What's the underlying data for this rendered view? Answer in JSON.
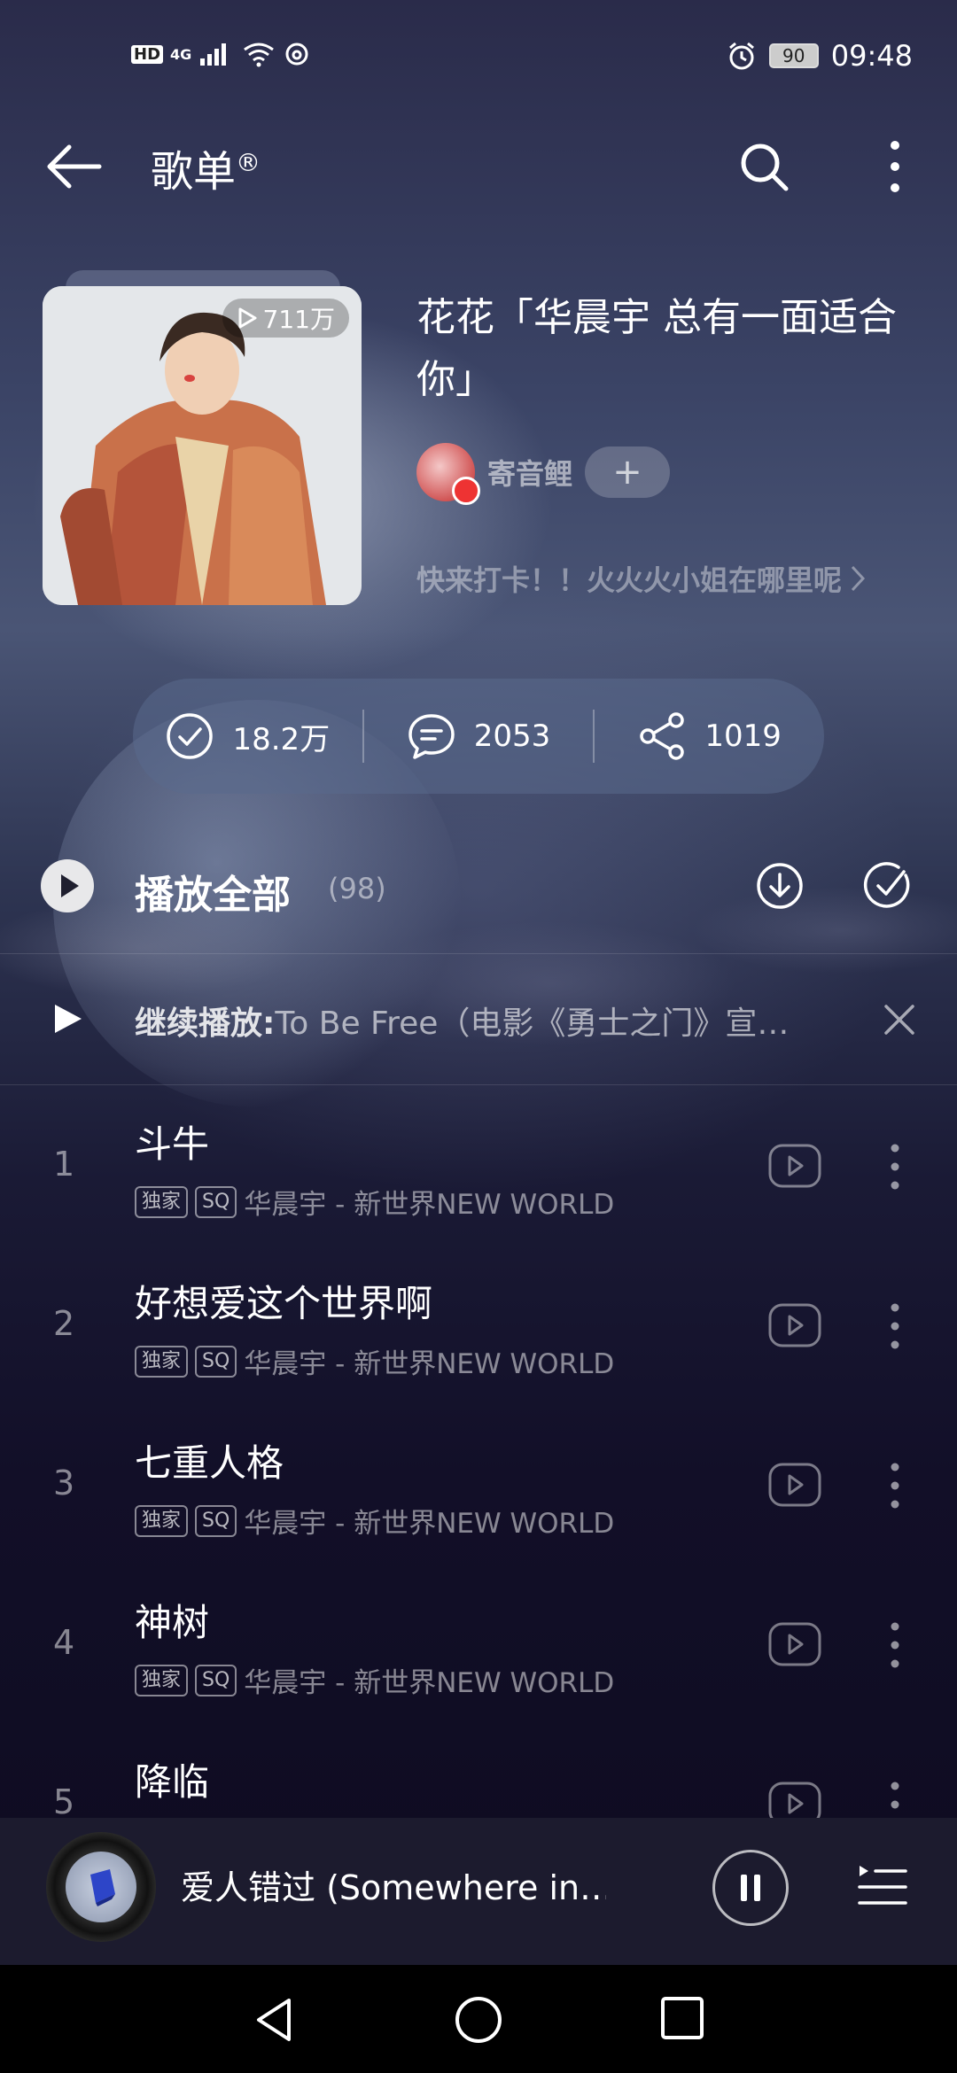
{
  "status_bar": {
    "network": "HD",
    "signal_type": "4G",
    "battery": "90",
    "time": "09:48"
  },
  "header": {
    "title": "歌单",
    "title_mark": "®"
  },
  "playlist": {
    "play_count": "711万",
    "title": "花花「华晨宇 总有一面适合你」",
    "creator_name": "寄音鲤",
    "follow_label": "+",
    "description": "快来打卡！！火火火小姐在哪里呢"
  },
  "stats": {
    "collect": "18.2万",
    "comments": "2053",
    "shares": "1019"
  },
  "play_all": {
    "label": "播放全部",
    "count": "(98)"
  },
  "resume": {
    "prefix": "继续播放:",
    "track": "To Be Free（电影《勇士之门》宣…"
  },
  "songs": [
    {
      "index": "1",
      "name": "斗牛",
      "tags": [
        "独家",
        "SQ"
      ],
      "artist_album": "华晨宇 - 新世界NEW WORLD"
    },
    {
      "index": "2",
      "name": "好想爱这个世界啊",
      "tags": [
        "独家",
        "SQ"
      ],
      "artist_album": "华晨宇 - 新世界NEW WORLD"
    },
    {
      "index": "3",
      "name": "七重人格",
      "tags": [
        "独家",
        "SQ"
      ],
      "artist_album": "华晨宇 - 新世界NEW WORLD"
    },
    {
      "index": "4",
      "name": "神树",
      "tags": [
        "独家",
        "SQ"
      ],
      "artist_album": "华晨宇 - 新世界NEW WORLD"
    },
    {
      "index": "5",
      "name": "降临",
      "tags": [],
      "artist_album": ""
    }
  ],
  "player": {
    "now_playing": "爱人错过 (Somewhere in…"
  },
  "colors": {
    "accent_red": "#e33333",
    "player_bg": "#1c1b2e",
    "stats_pill": "#5a698c"
  },
  "icons": {
    "back": "arrow-left-icon",
    "search": "search-icon",
    "more": "more-vertical-icon",
    "collect": "check-circle-icon",
    "comment": "comment-icon",
    "share": "share-icon",
    "download": "download-circle-icon",
    "multi_select": "check-circle-icon",
    "close": "close-icon",
    "pause": "pause-icon",
    "queue": "playlist-icon"
  }
}
